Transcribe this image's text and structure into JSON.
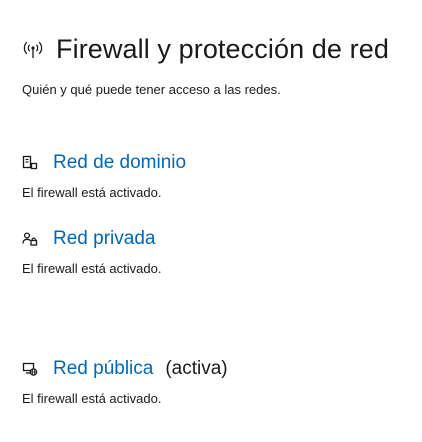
{
  "header": {
    "title": "Firewall y protección de red",
    "icon": "wifi-signal-icon",
    "subtitle": "Quién y qué puede tener acceso a las redes."
  },
  "networks": [
    {
      "icon": "domain-network-icon",
      "label": "Red de dominio",
      "active_label": "",
      "status": "El firewall está activado."
    },
    {
      "icon": "private-network-icon",
      "label": "Red privada",
      "active_label": "",
      "status": "El firewall está activado."
    },
    {
      "icon": "public-network-icon",
      "label": "Red pública",
      "active_label": "(activa)",
      "status": "El firewall está activado."
    }
  ],
  "colors": {
    "link": "#0067b8",
    "text": "#1a1a1a",
    "background": "#ffffff"
  }
}
